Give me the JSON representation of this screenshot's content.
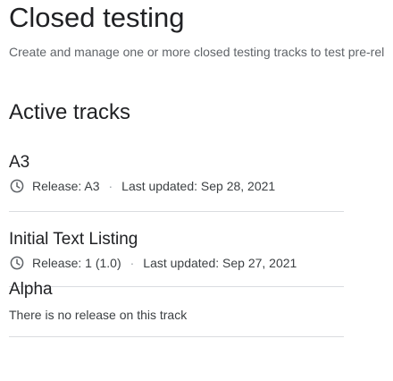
{
  "page": {
    "title": "Closed testing",
    "subtitle": "Create and manage one or more closed testing tracks to test pre-rel"
  },
  "active_tracks": {
    "heading": "Active tracks",
    "tracks": [
      {
        "name": "A3",
        "icon": "clock-icon",
        "release": "Release: A3",
        "separator": "·",
        "updated": "Last updated: Sep 28, 2021"
      },
      {
        "name": "Initial Text Listing",
        "icon": "clock-icon",
        "release": "Release: 1 (1.0)",
        "separator": "·",
        "updated": "Last updated: Sep 27, 2021"
      },
      {
        "name": "Alpha",
        "empty_message": "There is no release on this track"
      }
    ]
  }
}
